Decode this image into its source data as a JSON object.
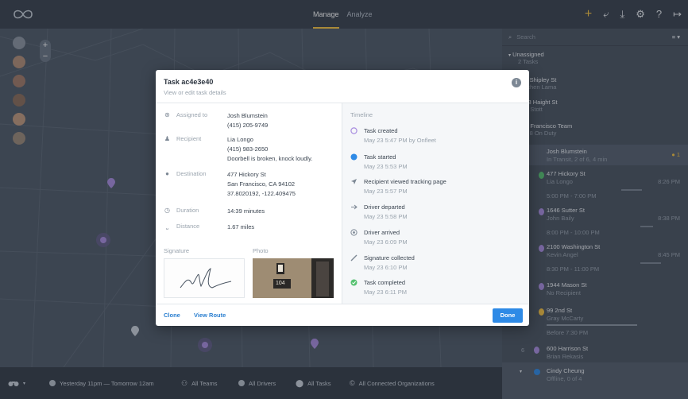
{
  "topbar": {
    "nav": [
      "Manage",
      "Analyze"
    ],
    "active_nav": "Manage",
    "actions": [
      "plus-icon",
      "import-icon",
      "download-icon",
      "gear-icon",
      "help-icon",
      "logout-icon"
    ]
  },
  "map_controls": {
    "zoom_in": "+",
    "zoom_out": "−"
  },
  "bottombar": {
    "time_range": "Yesterday 11pm — Tomorrow 12am",
    "teams": "All Teams",
    "drivers": "All Drivers",
    "tasks": "All Tasks",
    "orgs": "All Connected Organizations"
  },
  "panel": {
    "search_placeholder": "Search",
    "unassigned_title": "Unassigned",
    "unassigned_count": "2 Tasks",
    "items": [
      {
        "title": "133 Shipley St",
        "sub": "Rinchen Lama"
      },
      {
        "title": "1298 Haight St",
        "sub": "Ben Stott"
      },
      {
        "title": "San Francisco Team",
        "sub": "5 of 8 On Duty"
      },
      {
        "title": "Josh Blumstein",
        "sub": "In Transit, 2 of 6, 4 min",
        "badge": "1"
      },
      {
        "title": "477 Hickory St",
        "sub": "Lia Longo",
        "time": "8:26 PM",
        "window": "5:00 PM - 7:00 PM"
      },
      {
        "title": "1646 Sutter St",
        "sub": "John Baily",
        "time": "8:38 PM",
        "window": "8:00 PM - 10:00 PM"
      },
      {
        "title": "2100 Washington St",
        "sub": "Kevin Angel",
        "time": "8:45 PM",
        "window": "8:30 PM - 11:00 PM"
      },
      {
        "title": "1944 Mason St",
        "sub": "No Recipient"
      },
      {
        "title": "99 2nd St",
        "sub": "Gray McCarty",
        "window": "Before 7:30 PM"
      },
      {
        "title": "600 Harrison St",
        "sub": "Brian Rekasis",
        "num": "6"
      },
      {
        "title": "Cindy Cheung",
        "sub": "Offline, 0 of 4"
      }
    ]
  },
  "modal": {
    "title": "Task ac4e3e40",
    "subtitle": "View or edit task details",
    "fields": {
      "assigned_label": "Assigned to",
      "assigned_name": "Josh Blumstein",
      "assigned_phone": "(415) 205-9749",
      "recipient_label": "Recipient",
      "recipient_name": "Lia Longo",
      "recipient_phone": "(415) 983-2650",
      "recipient_note": "Doorbell is broken, knock loudly.",
      "destination_label": "Destination",
      "destination_line1": "477 Hickory St",
      "destination_line2": "San Francisco, CA 94102",
      "destination_coords": "37.8020192, -122.409475",
      "duration_label": "Duration",
      "duration_value": "14:39 minutes",
      "distance_label": "Distance",
      "distance_value": "1.67 miles"
    },
    "signature_label": "Signature",
    "photo_label": "Photo",
    "photo_number": "104",
    "timeline_title": "Timeline",
    "timeline": [
      {
        "label": "Task created",
        "time": "May 23 5:47 PM by Onfleet"
      },
      {
        "label": "Task started",
        "time": "May 23 5:53 PM"
      },
      {
        "label": "Recipient viewed tracking page",
        "time": "May 23 5:57 PM"
      },
      {
        "label": "Driver departed",
        "time": "May 23 5:58 PM"
      },
      {
        "label": "Driver arrived",
        "time": "May 23 6:09 PM"
      },
      {
        "label": "Signature collected",
        "time": "May 23 6:10 PM"
      },
      {
        "label": "Task completed",
        "time": "May 23 6:11 PM"
      }
    ],
    "footer": {
      "clone": "Clone",
      "view_route": "View Route",
      "done": "Done"
    }
  },
  "colors": {
    "accent_blue": "#2e8ae6",
    "purple": "#a98ee0",
    "yellow": "#f6c342",
    "green": "#56c271"
  }
}
